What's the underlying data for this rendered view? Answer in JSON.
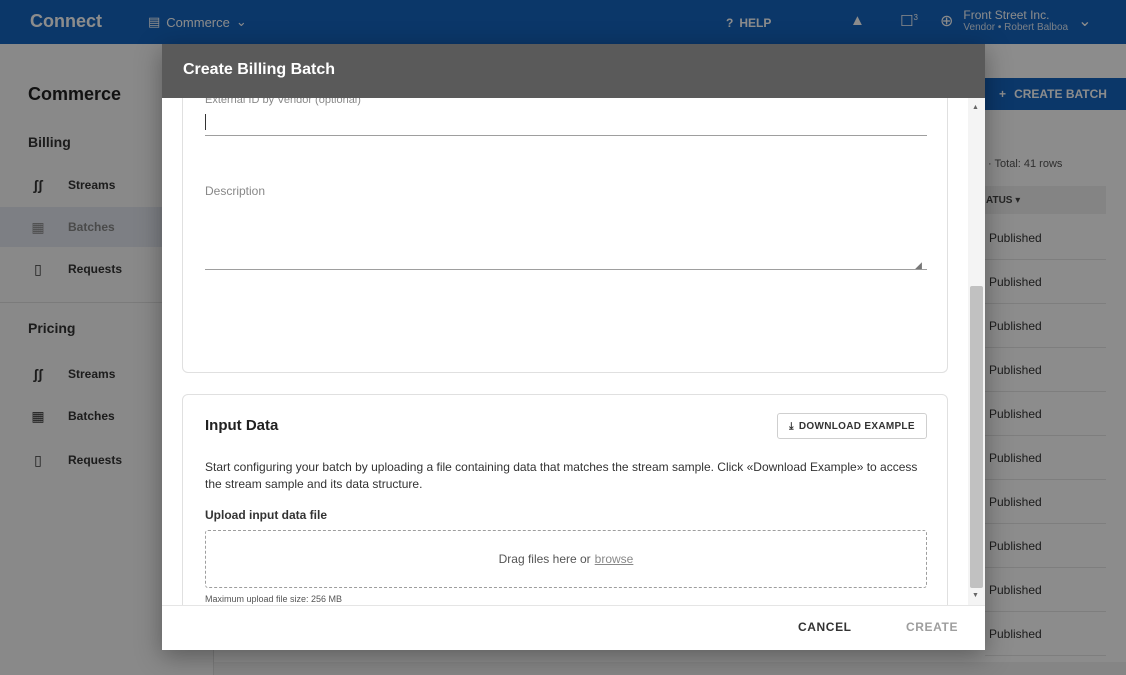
{
  "app": {
    "brand": "Connect",
    "module": "Commerce",
    "help": "HELP",
    "notifications_count": "3",
    "account_name": "Front Street Inc.",
    "account_sub": "Vendor • Robert Balboa"
  },
  "sidebar": {
    "title": "Commerce",
    "billing": {
      "heading": "Billing",
      "items": [
        {
          "label": "Streams"
        },
        {
          "label": "Batches"
        },
        {
          "label": "Requests"
        }
      ]
    },
    "pricing": {
      "heading": "Pricing",
      "items": [
        {
          "label": "Streams"
        },
        {
          "label": "Batches"
        },
        {
          "label": "Requests"
        }
      ]
    }
  },
  "main": {
    "create_batch_label": "CREATE BATCH",
    "total_rows": "Total: 41 rows",
    "status_header": "ATUS",
    "rows": [
      "Published",
      "Published",
      "Published",
      "Published",
      "Published",
      "Published",
      "Published",
      "Published",
      "Published",
      "Published"
    ]
  },
  "dialog": {
    "title": "Create Billing Batch",
    "external_id": {
      "label": "External ID by Vendor (optional)",
      "value": ""
    },
    "description": {
      "label": "Description",
      "value": ""
    },
    "input_data": {
      "title": "Input Data",
      "download_label": "DOWNLOAD EXAMPLE",
      "description": "Start configuring your batch by uploading a file containing data that matches the stream sample. Click «Download Example» to access the stream sample and its data structure.",
      "upload_label": "Upload input data file",
      "dropzone_text": "Drag files here or",
      "browse_label": "browse",
      "max_size": "Maximum upload file size: 256 MB"
    },
    "footer": {
      "cancel_label": "CANCEL",
      "create_label": "CREATE"
    }
  }
}
